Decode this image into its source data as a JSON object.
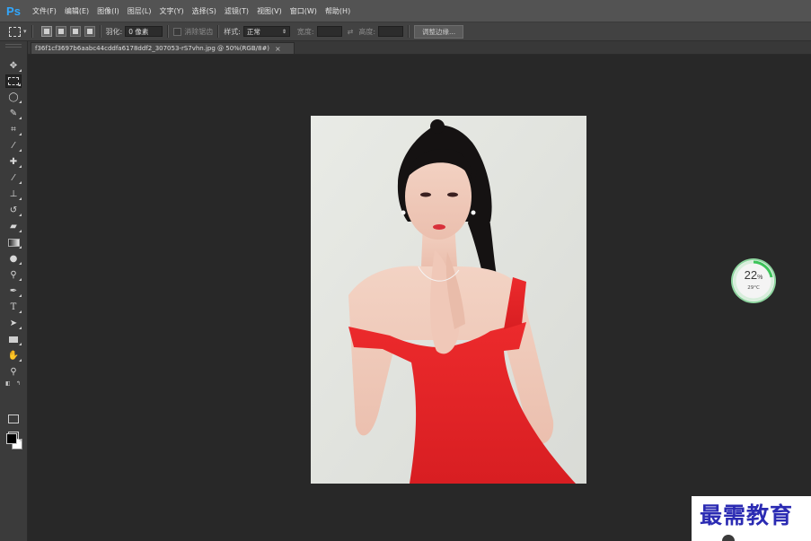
{
  "app": {
    "logo": "Ps"
  },
  "menu": [
    "文件(F)",
    "编辑(E)",
    "图像(I)",
    "图层(L)",
    "文字(Y)",
    "选择(S)",
    "滤镜(T)",
    "视图(V)",
    "窗口(W)",
    "帮助(H)"
  ],
  "options": {
    "feather_label": "羽化:",
    "feather_value": "0 像素",
    "antialias_label": "消除锯齿",
    "style_label": "样式:",
    "style_value": "正常",
    "width_label": "宽度:",
    "height_label": "高度:",
    "refine_edge": "调整边缘..."
  },
  "document": {
    "tab_title": "f36f1cf3697b6aabc44cddfa6178ddf2_307053-rS7vhn.jpg @ 50%(RGB/8#)",
    "close_glyph": "×"
  },
  "tools": [
    "move-tool",
    "marquee-tool",
    "lasso-tool",
    "quick-selection-tool",
    "crop-tool",
    "eyedropper-tool",
    "healing-brush-tool",
    "brush-tool",
    "clone-stamp-tool",
    "history-brush-tool",
    "eraser-tool",
    "gradient-tool",
    "blur-tool",
    "dodge-tool",
    "pen-tool",
    "type-tool",
    "path-selection-tool",
    "rectangle-tool",
    "hand-tool",
    "zoom-tool"
  ],
  "colors": {
    "foreground": "#000000",
    "background": "#ffffff",
    "dress": "#e8282a",
    "accent": "#31a8ff"
  },
  "widget": {
    "percent": "22",
    "percent_unit": "%",
    "temperature": "29°C"
  },
  "watermark": {
    "text": "最需教育"
  }
}
